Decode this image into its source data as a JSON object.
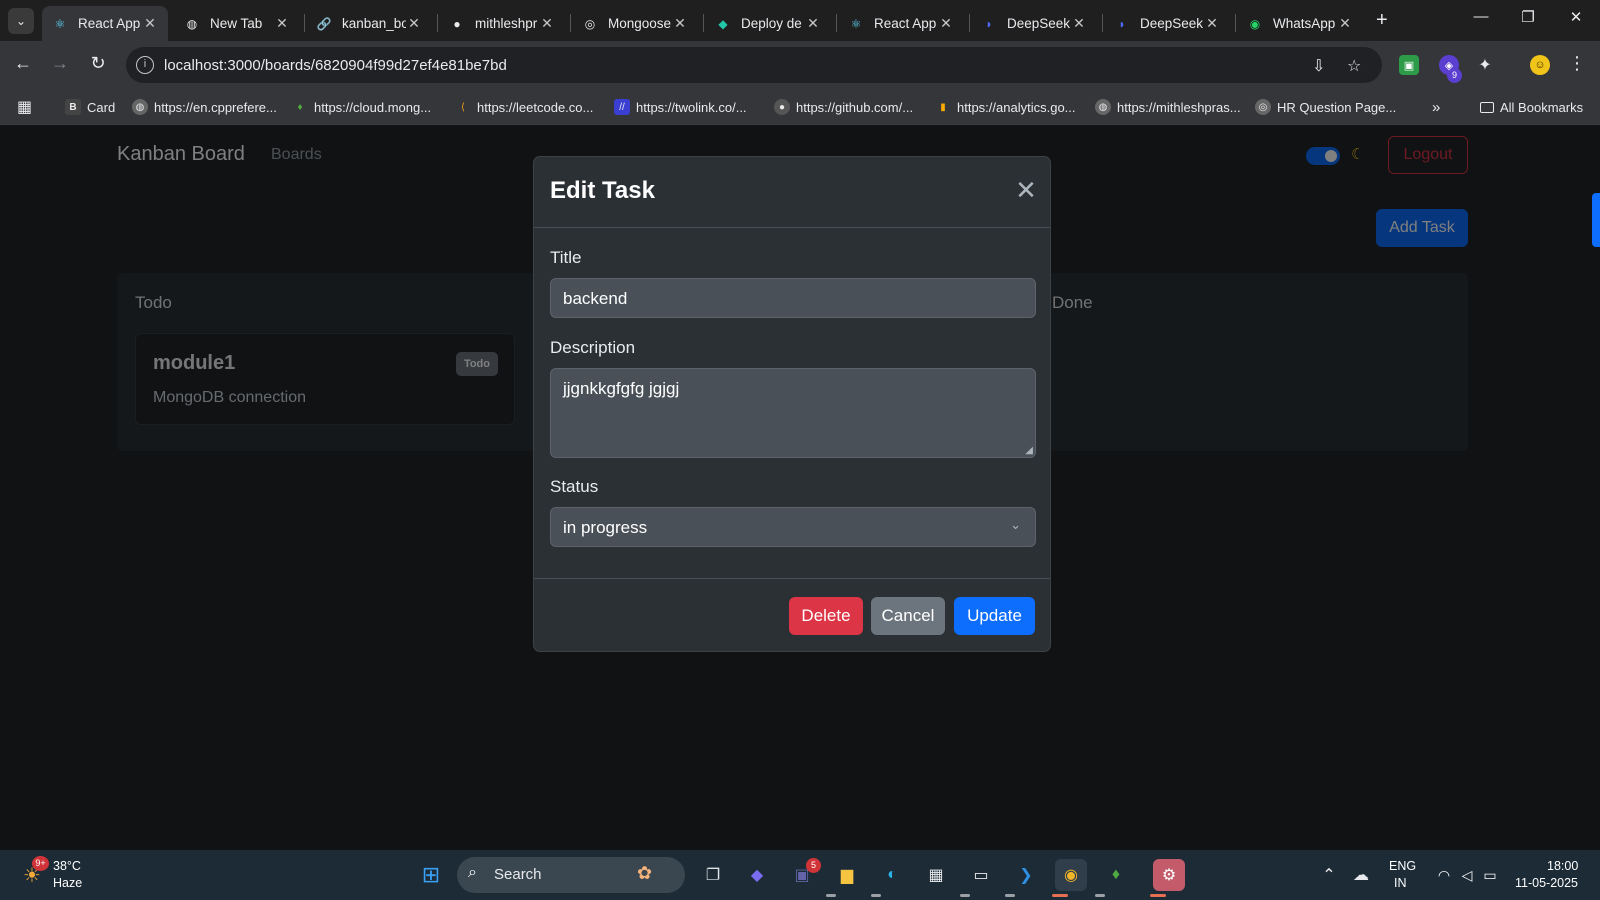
{
  "browser": {
    "tabs": [
      {
        "label": "React App",
        "icon": "react-icon",
        "active": true
      },
      {
        "label": "New Tab",
        "icon": "globe-icon"
      },
      {
        "label": "kanban_bo",
        "icon": "link-icon"
      },
      {
        "label": "mithleshpr",
        "icon": "github-icon"
      },
      {
        "label": "Mongoose",
        "icon": "mongoose-icon"
      },
      {
        "label": "Deploy de",
        "icon": "deploy-icon"
      },
      {
        "label": "React App",
        "icon": "react-icon"
      },
      {
        "label": "DeepSeek",
        "icon": "deepseek-icon"
      },
      {
        "label": "DeepSeek",
        "icon": "deepseek-icon"
      },
      {
        "label": "WhatsApp",
        "icon": "whatsapp-icon"
      }
    ],
    "url": "localhost:3000/boards/6820904f99d27ef4e81be7bd",
    "bookmarks": [
      {
        "label": "Card"
      },
      {
        "label": "https://en.cpprefere..."
      },
      {
        "label": "https://cloud.mong..."
      },
      {
        "label": "https://leetcode.co..."
      },
      {
        "label": "https://twolink.co/..."
      },
      {
        "label": "https://github.com/..."
      },
      {
        "label": "https://analytics.go..."
      },
      {
        "label": "https://mithleshpras..."
      },
      {
        "label": "HR Question Page..."
      }
    ],
    "all_bookmarks": "All Bookmarks",
    "extension_badge": "9"
  },
  "app": {
    "brand": "Kanban Board",
    "nav_boards": "Boards",
    "logout": "Logout",
    "add_task": "Add Task",
    "columns": [
      "Todo",
      "Done"
    ],
    "task": {
      "title": "module1",
      "description": "MongoDB connection",
      "badge": "Todo"
    }
  },
  "modal": {
    "title": "Edit Task",
    "title_label": "Title",
    "title_value": "backend",
    "description_label": "Description",
    "description_value": "jjgnkkgfgfg jgjgj",
    "status_label": "Status",
    "status_value": "in progress",
    "buttons": {
      "delete": "Delete",
      "cancel": "Cancel",
      "update": "Update"
    }
  },
  "taskbar": {
    "weather_temp": "38°C",
    "weather_desc": "Haze",
    "weather_badge": "9+",
    "search": "Search",
    "teams_badge": "5",
    "lang": "ENG",
    "region": "IN",
    "time": "18:00",
    "date": "11-05-2025"
  },
  "colors": {
    "primary": "#0d6efd",
    "danger": "#dc3545",
    "secondary": "#6c757d",
    "modal_bg": "#2b3035"
  }
}
